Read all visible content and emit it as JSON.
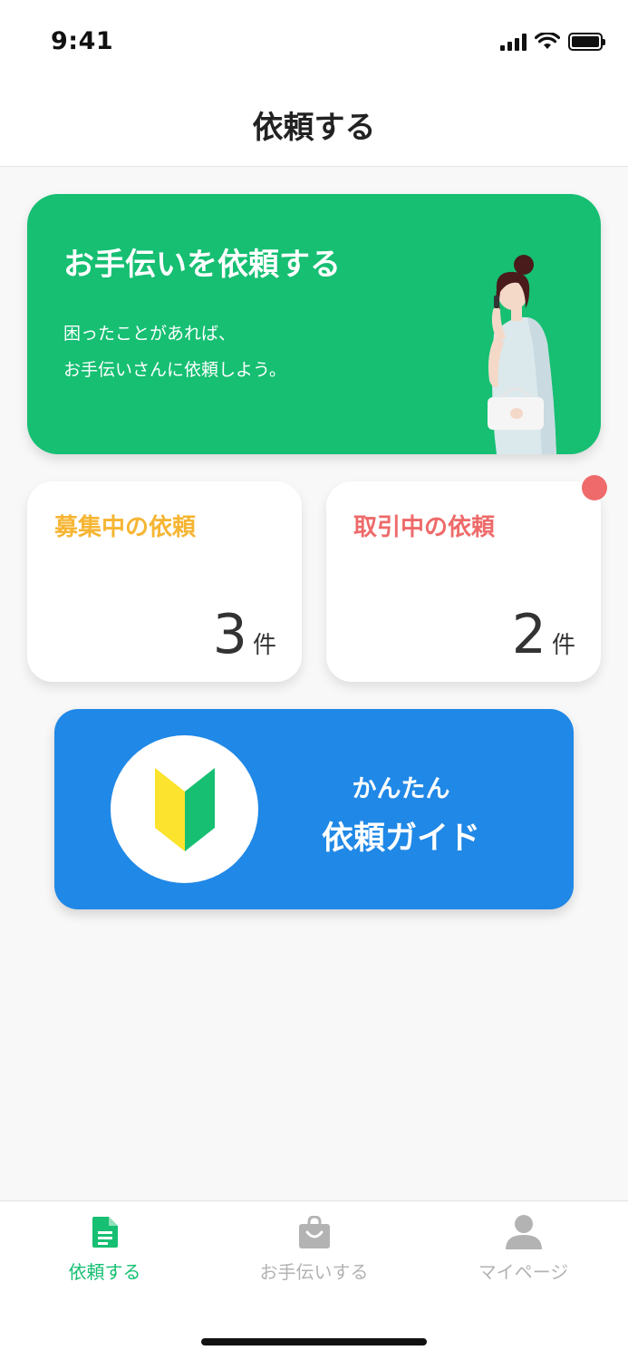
{
  "status_bar": {
    "time": "9:41"
  },
  "nav": {
    "title": "依頼する"
  },
  "hero": {
    "title": "お手伝いを依頼する",
    "description": [
      "困ったことがあれば、",
      "お手伝いさんに依頼しよう。"
    ],
    "color": "#16bf72"
  },
  "stats": {
    "recruiting": {
      "label": "募集中の依頼",
      "count": "3",
      "unit": "件",
      "color": "#f6b533"
    },
    "trading": {
      "label": "取引中の依頼",
      "count": "2",
      "unit": "件",
      "color": "#ee6a6a",
      "has_notification": true
    }
  },
  "guide": {
    "subtitle": "かんたん",
    "title": "依頼ガイド",
    "color": "#2088e6",
    "icon": "beginner-mark-icon"
  },
  "tab_bar": {
    "items": [
      {
        "label": "依頼する",
        "icon": "document-icon",
        "active": true
      },
      {
        "label": "お手伝いする",
        "icon": "shopping-bag-icon",
        "active": false
      },
      {
        "label": "マイページ",
        "icon": "person-icon",
        "active": false
      }
    ],
    "active_color": "#16bf72",
    "inactive_color": "#b3b3b3"
  }
}
